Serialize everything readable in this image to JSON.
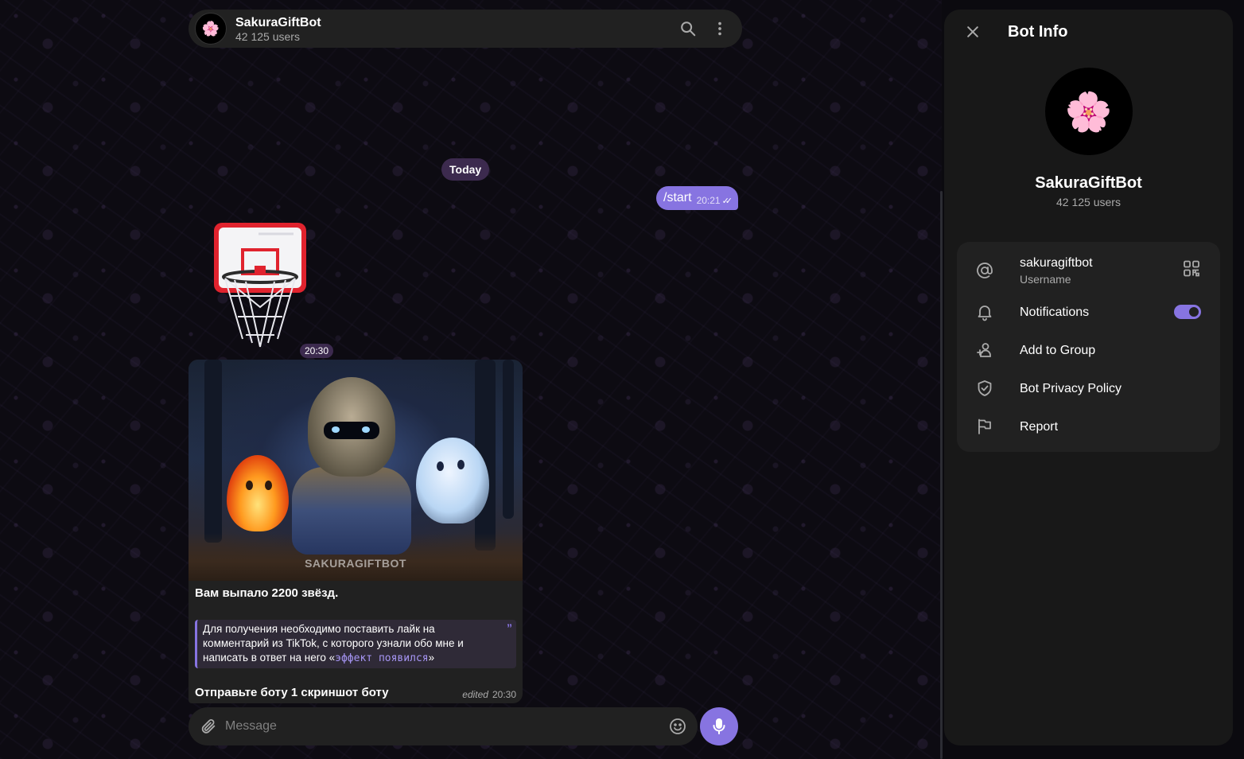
{
  "chat": {
    "title": "SakuraGiftBot",
    "subtitle": "42 125 users",
    "avatar_emoji": "🌸",
    "date_label": "Today",
    "outgoing": {
      "text": "/start",
      "time": "20:21",
      "ticks": "✓✓"
    },
    "sticker": {
      "icon": "basketball-hoop-sticker",
      "time": "20:30"
    },
    "photo_message": {
      "watermark": "SAKURAGIFTBOT",
      "title": "Вам выпало 2200 звёзд.",
      "quote_text": "Для получения необходимо поставить лайк на комментарий из TikTok, с которого узнали обо мне и написать в ответ на него «",
      "quote_code": "эффект появился",
      "quote_end": "»",
      "quote_mark": "”",
      "footer_text": "Отправьте боту 1 скриншот боту",
      "edited": "edited",
      "time": "20:30"
    },
    "composer": {
      "placeholder": "Message"
    }
  },
  "panel": {
    "title": "Bot Info",
    "avatar_emoji": "🌸",
    "name": "SakuraGiftBot",
    "subtitle": "42 125 users",
    "rows": [
      {
        "icon": "at-icon",
        "label": "sakuragiftbot",
        "secondary": "Username",
        "right": "qr-code-icon"
      },
      {
        "icon": "bell-icon",
        "label": "Notifications",
        "toggle": true
      },
      {
        "icon": "add-user-icon",
        "label": "Add to Group"
      },
      {
        "icon": "shield-check-icon",
        "label": "Bot Privacy Policy"
      },
      {
        "icon": "flag-icon",
        "label": "Report"
      }
    ]
  },
  "colors": {
    "accent": "#8774e1",
    "surface": "#212121",
    "panel": "#181818",
    "date_pill": "#3c2a4e"
  }
}
